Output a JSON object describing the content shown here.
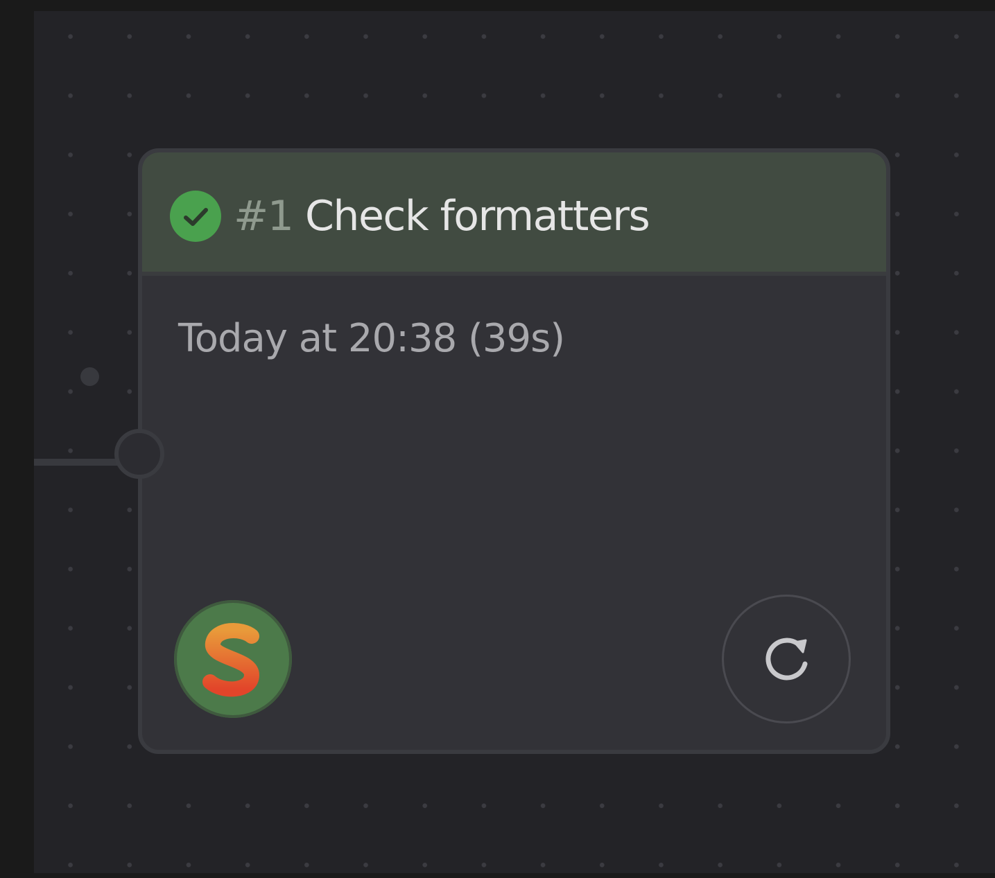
{
  "node": {
    "status": "success",
    "status_icon": "check-circle-icon",
    "status_color": "#4aa14e",
    "number": "#1",
    "title": "Check formatters",
    "time": "Today at 20:38 (39s)",
    "header_color": "#414b41",
    "avatar_icon": "s-logo-icon",
    "rerun_icon": "refresh-icon"
  }
}
